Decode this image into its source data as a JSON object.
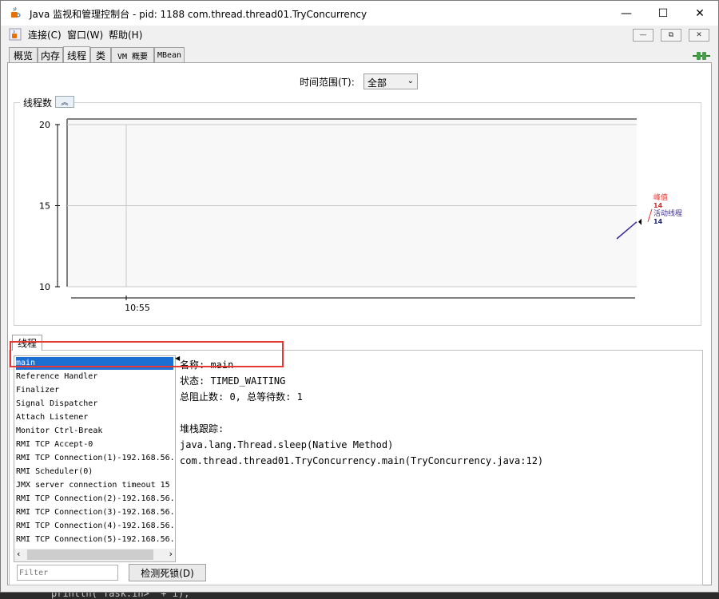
{
  "window": {
    "title": "Java 监视和管理控制台 - pid: 1188 com.thread.thread01.TryConcurrency",
    "controls": {
      "minimize": "—",
      "maximize": "☐",
      "close": "✕"
    }
  },
  "menubar": {
    "items": [
      "连接(C)",
      "窗口(W)",
      "帮助(H)"
    ],
    "mdi_controls": {
      "minimize": "—",
      "restore": "⧉",
      "close": "✕"
    }
  },
  "tabs": [
    "概览",
    "内存",
    "线程",
    "类",
    "VM 概要",
    "MBean"
  ],
  "active_tab": "线程",
  "time_range": {
    "label": "时间范围(T):",
    "value": "全部"
  },
  "chart_data": {
    "type": "line",
    "title": "线程数",
    "ylim": [
      10,
      20
    ],
    "y_ticks": [
      "20",
      "15",
      "10"
    ],
    "x_ticks": [
      "10:55"
    ],
    "series": [
      {
        "name": "峰值",
        "color": "#e53935",
        "value": 14
      },
      {
        "name": "活动线程",
        "color": "#3f2a9c",
        "value": 14
      }
    ],
    "legend_position": "right"
  },
  "threads": {
    "tab_label": "线程",
    "items": [
      "main",
      "Reference Handler",
      "Finalizer",
      "Signal Dispatcher",
      "Attach Listener",
      "Monitor Ctrl-Break",
      "RMI TCP Accept-0",
      "RMI TCP Connection(1)-192.168.56.",
      "RMI Scheduler(0)",
      "JMX server connection timeout 15",
      "RMI TCP Connection(2)-192.168.56.",
      "RMI TCP Connection(3)-192.168.56.",
      "RMI TCP Connection(4)-192.168.56.",
      "RMI TCP Connection(5)-192.168.56."
    ],
    "selected": "main",
    "detail": {
      "name_line": "名称: main",
      "state_line": "状态: TIMED_WAITING",
      "counts_line": "总阻止数: 0, 总等待数: 1",
      "stack_header": "堆栈跟踪:",
      "stack": [
        "java.lang.Thread.sleep(Native Method)",
        "com.thread.thread01.TryConcurrency.main(TryConcurrency.java:12)"
      ]
    },
    "filter_placeholder": "Filter",
    "detect_deadlock": "检测死锁(D)"
  },
  "background_code": "println(\"Task.in>\" + i);"
}
